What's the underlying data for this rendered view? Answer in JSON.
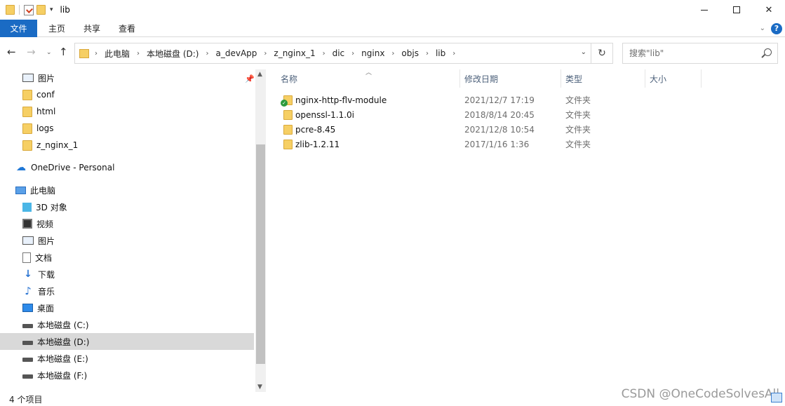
{
  "window": {
    "title": "lib"
  },
  "ribbon": {
    "tabs": [
      "文件",
      "主页",
      "共享",
      "查看"
    ]
  },
  "address": {
    "crumbs": [
      "此电脑",
      "本地磁盘 (D:)",
      "a_devApp",
      "z_nginx_1",
      "dic",
      "nginx",
      "objs",
      "lib"
    ]
  },
  "search": {
    "placeholder": "搜索\"lib\""
  },
  "nav": {
    "quick": [
      {
        "label": "图片",
        "icon": "pictures-icon"
      },
      {
        "label": "conf",
        "icon": "folder-icon"
      },
      {
        "label": "html",
        "icon": "folder-icon"
      },
      {
        "label": "logs",
        "icon": "folder-icon"
      },
      {
        "label": "z_nginx_1",
        "icon": "folder-icon"
      }
    ],
    "onedrive": "OneDrive - Personal",
    "thispc": "此电脑",
    "pc_items": [
      {
        "label": "3D 对象",
        "icon": "3d-objects-icon"
      },
      {
        "label": "视频",
        "icon": "videos-icon"
      },
      {
        "label": "图片",
        "icon": "pictures-icon"
      },
      {
        "label": "文档",
        "icon": "documents-icon"
      },
      {
        "label": "下载",
        "icon": "downloads-icon"
      },
      {
        "label": "音乐",
        "icon": "music-icon"
      },
      {
        "label": "桌面",
        "icon": "desktop-icon"
      },
      {
        "label": "本地磁盘 (C:)",
        "icon": "drive-icon"
      },
      {
        "label": "本地磁盘 (D:)",
        "icon": "drive-icon"
      },
      {
        "label": "本地磁盘 (E:)",
        "icon": "drive-icon"
      },
      {
        "label": "本地磁盘 (F:)",
        "icon": "drive-icon"
      }
    ],
    "selected": "本地磁盘 (D:)"
  },
  "columns": {
    "name": "名称",
    "date": "修改日期",
    "type": "类型",
    "size": "大小"
  },
  "files": [
    {
      "name": "nginx-http-flv-module",
      "date": "2021/12/7 17:19",
      "type": "文件夹",
      "synced": true
    },
    {
      "name": "openssl-1.1.0i",
      "date": "2018/8/14 20:45",
      "type": "文件夹",
      "synced": false
    },
    {
      "name": "pcre-8.45",
      "date": "2021/12/8 10:54",
      "type": "文件夹",
      "synced": false
    },
    {
      "name": "zlib-1.2.11",
      "date": "2017/1/16 1:36",
      "type": "文件夹",
      "synced": false
    }
  ],
  "status": {
    "count": "4 个项目"
  },
  "watermark": "CSDN @OneCodeSolvesAll",
  "colors": {
    "accent": "#1a6bc4",
    "folder": "#f6cf64",
    "selection": "#d9d9d9"
  }
}
